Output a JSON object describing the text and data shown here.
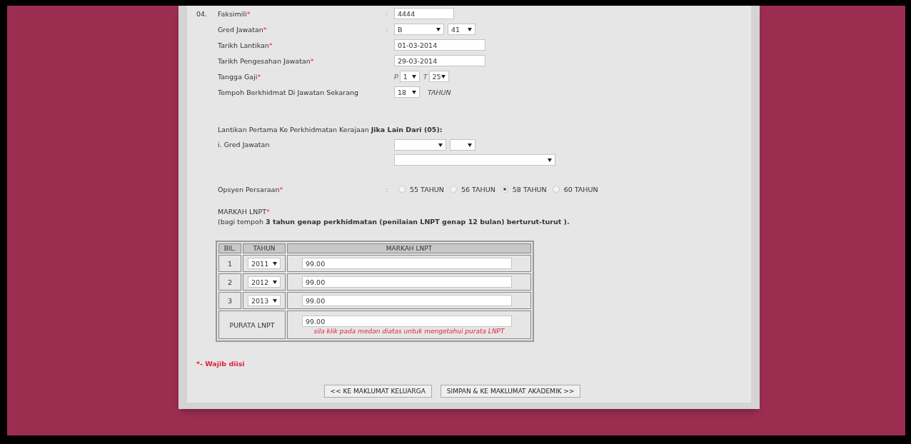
{
  "section_number": "04.",
  "required_mark": "*",
  "colon": ":",
  "fields": [
    {
      "kind": "text",
      "label": "Faksimili",
      "required": true,
      "colon": true,
      "value": "4444"
    },
    {
      "kind": "selects",
      "label": "Gred Jawatan",
      "required": true,
      "colon": true,
      "selects": [
        {
          "value": "B"
        },
        {
          "value": "41"
        }
      ]
    },
    {
      "kind": "text",
      "label": "Tarikh Lantikan",
      "required": true,
      "colon": false,
      "value": "01-03-2014"
    },
    {
      "kind": "text",
      "label": "Tarikh Pengesahan Jawatan",
      "required": true,
      "colon": false,
      "value": "29-03-2014"
    },
    {
      "kind": "salary",
      "label": "Tangga Gaji",
      "required": true,
      "colon": false,
      "parts": [
        {
          "prefix": "P",
          "value": "1"
        },
        {
          "prefix": "T",
          "value": "25"
        }
      ]
    },
    {
      "kind": "duration",
      "label": "Tempoh Berkhidmat Di Jawatan Sekarang",
      "required": false,
      "colon": false,
      "value": "18",
      "suffix": "TAHUN"
    }
  ],
  "first_appointment": {
    "heading": "Lantikan Pertama Ke Perkhidmatan Kerajaan **Jika Lain Dari (05):**",
    "label": "i. Gred Jawatan"
  },
  "retirement": {
    "label": "Opsyen Persaraan",
    "required": true,
    "options": [
      {
        "label": "55 TAHUN",
        "selected": false
      },
      {
        "label": "56 TAHUN",
        "selected": false
      },
      {
        "label": "58 TAHUN",
        "selected": true
      },
      {
        "label": "60 TAHUN",
        "selected": false
      }
    ]
  },
  "lnpt": {
    "title": "MARKAH LNPT",
    "required": true,
    "note": "(bagi tempoh **3 tahun genap perkhidmatan (penilaian LNPT genap 12 bulan) berturut-turut ).**",
    "columns": [
      "BIL.",
      "TAHUN",
      "MARKAH LNPT"
    ],
    "rows": [
      {
        "bil": "1",
        "tahun": "2011",
        "markah": "99.00"
      },
      {
        "bil": "2",
        "tahun": "2012",
        "markah": "99.00"
      },
      {
        "bil": "3",
        "tahun": "2013",
        "markah": "99.00"
      }
    ],
    "average": {
      "label": "PURATA LNPT",
      "value": "99.00",
      "hint": "sila klik pada medan diatas untuk mengetahui purata LNPT"
    }
  },
  "required_note": "*- Wajib diisi",
  "buttons": [
    "<< KE MAKLUMAT KELUARGA",
    "SIMPAN & KE MAKLUMAT AKADEMIK >>"
  ]
}
